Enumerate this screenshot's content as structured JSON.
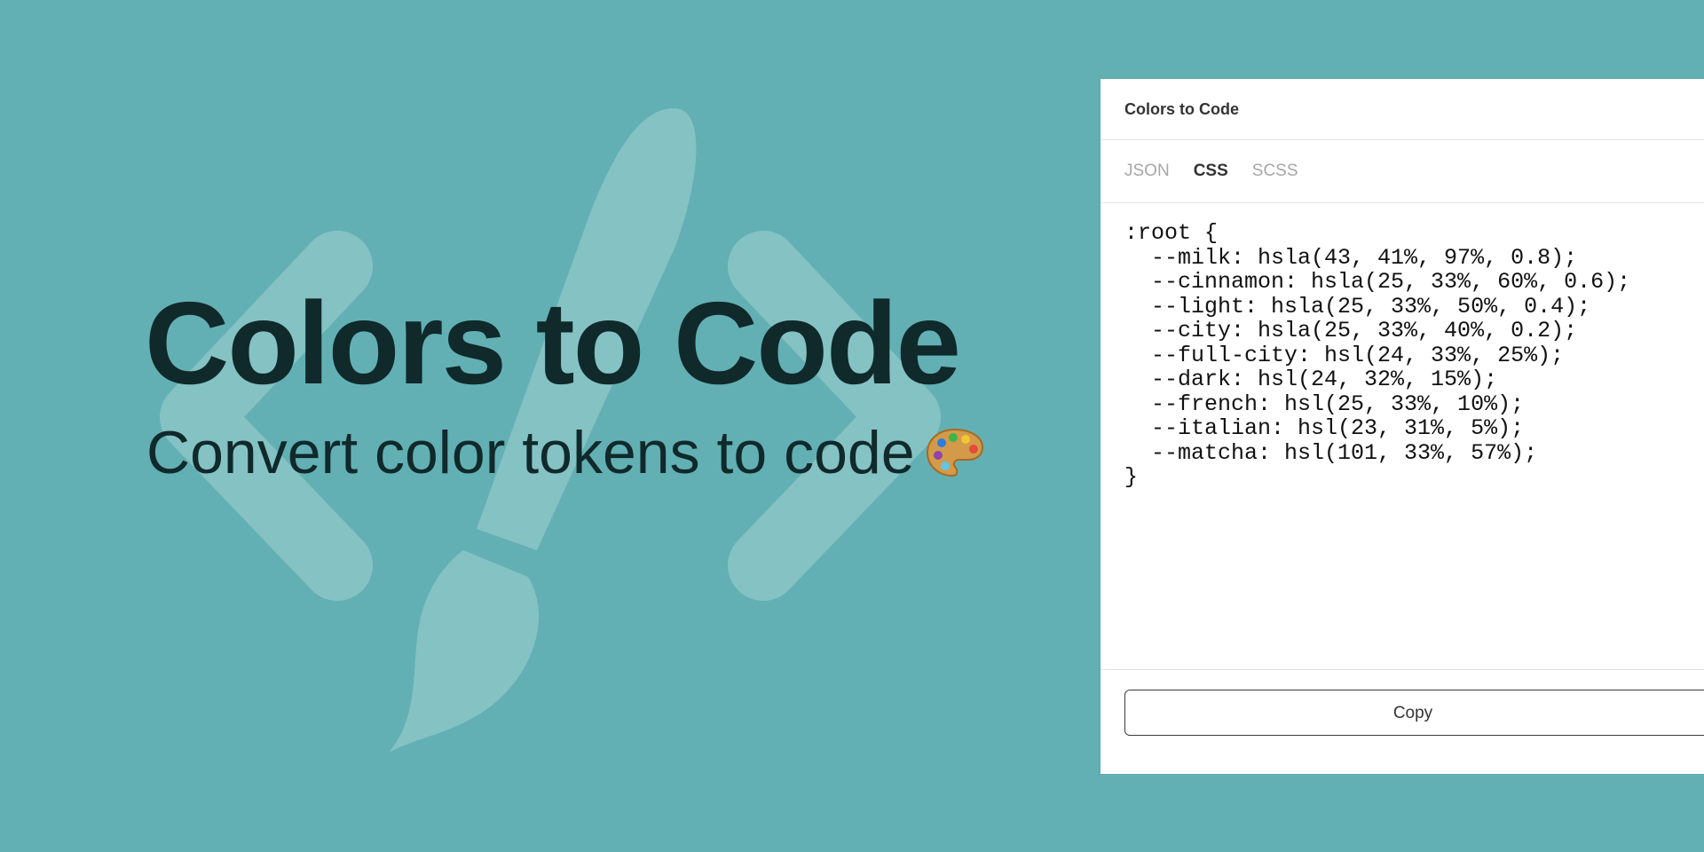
{
  "hero": {
    "title": "Colors to Code",
    "subtitle": "Convert color tokens to code"
  },
  "panel": {
    "title": "Colors to Code",
    "tabs": [
      {
        "label": "JSON",
        "active": false
      },
      {
        "label": "CSS",
        "active": true
      },
      {
        "label": "SCSS",
        "active": false
      }
    ],
    "code_lines": [
      ":root {",
      "  --milk: hsla(43, 41%, 97%, 0.8);",
      "  --cinnamon: hsla(25, 33%, 60%, 0.6);",
      "  --light: hsla(25, 33%, 50%, 0.4);",
      "  --city: hsla(25, 33%, 40%, 0.2);",
      "  --full-city: hsl(24, 33%, 25%);",
      "  --dark: hsl(24, 32%, 15%);",
      "  --french: hsl(25, 33%, 10%);",
      "  --italian: hsl(23, 31%, 5%);",
      "  --matcha: hsl(101, 33%, 57%);",
      "}"
    ],
    "copy_label": "Copy"
  },
  "icons": {
    "background": [
      "code-brackets-icon",
      "paintbrush-icon"
    ],
    "subtitle_emoji": "artist-palette-icon"
  },
  "colors": {
    "background": "#62b0b4",
    "heading": "#10292b",
    "panel": "#ffffff"
  }
}
